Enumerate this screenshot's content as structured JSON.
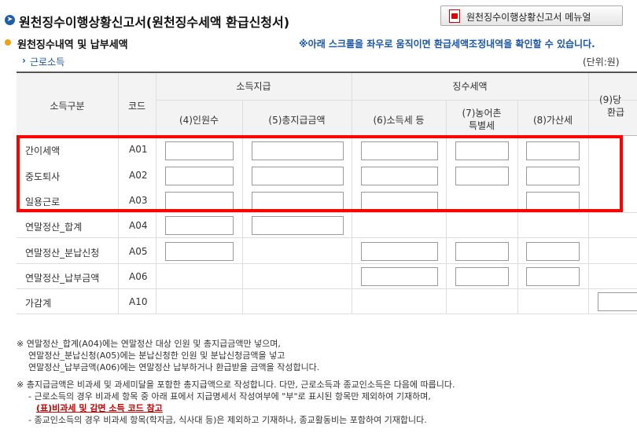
{
  "header": {
    "title": "원천징수이행상황신고서(원천징수세액 환급신청서)",
    "manual_button": "원천징수이행상황신고서 메뉴얼"
  },
  "section": {
    "title": "원천징수내역 및 납부세액",
    "scroll_note": "※아래 스크롤을 좌우로 움직이면 환급세액조정내역을 확인할 수 있습니다.",
    "sub_title": "근로소득",
    "unit": "(단위:원)"
  },
  "table": {
    "headers": {
      "category": "소득구분",
      "code": "코드",
      "payment_group": "소득지급",
      "withholding_group": "징수세액",
      "people": "(4)인원수",
      "total_pay": "(5)총지급금액",
      "income_tax": "(6)소득세 등",
      "rural_tax_1": "(7)농어촌",
      "rural_tax_2": "특별세",
      "surcharge": "(8)가산세",
      "refund_1": "(9)당",
      "refund_2": "환급"
    },
    "rows": [
      {
        "label": "간이세액",
        "code": "A01"
      },
      {
        "label": "중도퇴사",
        "code": "A02"
      },
      {
        "label": "일용근로",
        "code": "A03"
      },
      {
        "label": "연말정산_합계",
        "code": "A04"
      },
      {
        "label": "연말정산_분납신청",
        "code": "A05"
      },
      {
        "label": "연말정산_납부금액",
        "code": "A06"
      },
      {
        "label": "가감계",
        "code": "A10"
      }
    ]
  },
  "notes": {
    "n1_l1": "※ 연말정산_합계(A04)에는 연말정산 대상 인원 및 총지급금액만 넣으며,",
    "n1_l2": "연말정산_분납신청(A05)에는 분납신청한 인원 및 분납신청금액을 넣고",
    "n1_l3": "연말정산_납부금액(A06)에는 연말정산 납부하거나 환급받을 금액을 작성합니다.",
    "n2_l1": "※ 총지급금액은 비과세 및 과세미달을 포함한 총지급액으로 작성합니다. 다만, 근로소득과 종교인소득은 다음에 따릅니다.",
    "n2_l2": "- 근로소득의 경우 비과세 항목 중 아래 표에서 지급명세서 작성여부에 \"부\"로 표시된 항목만 제외하여 기재하며,",
    "n2_link": "(표)비과세 및 감면 소득 코드 참고",
    "n2_l3": "- 종교인소득의 경우 비과세 항목(학자금, 식사대 등)은 제외하고 기재하나, 종교활동비는 포함하여 기재합니다."
  }
}
